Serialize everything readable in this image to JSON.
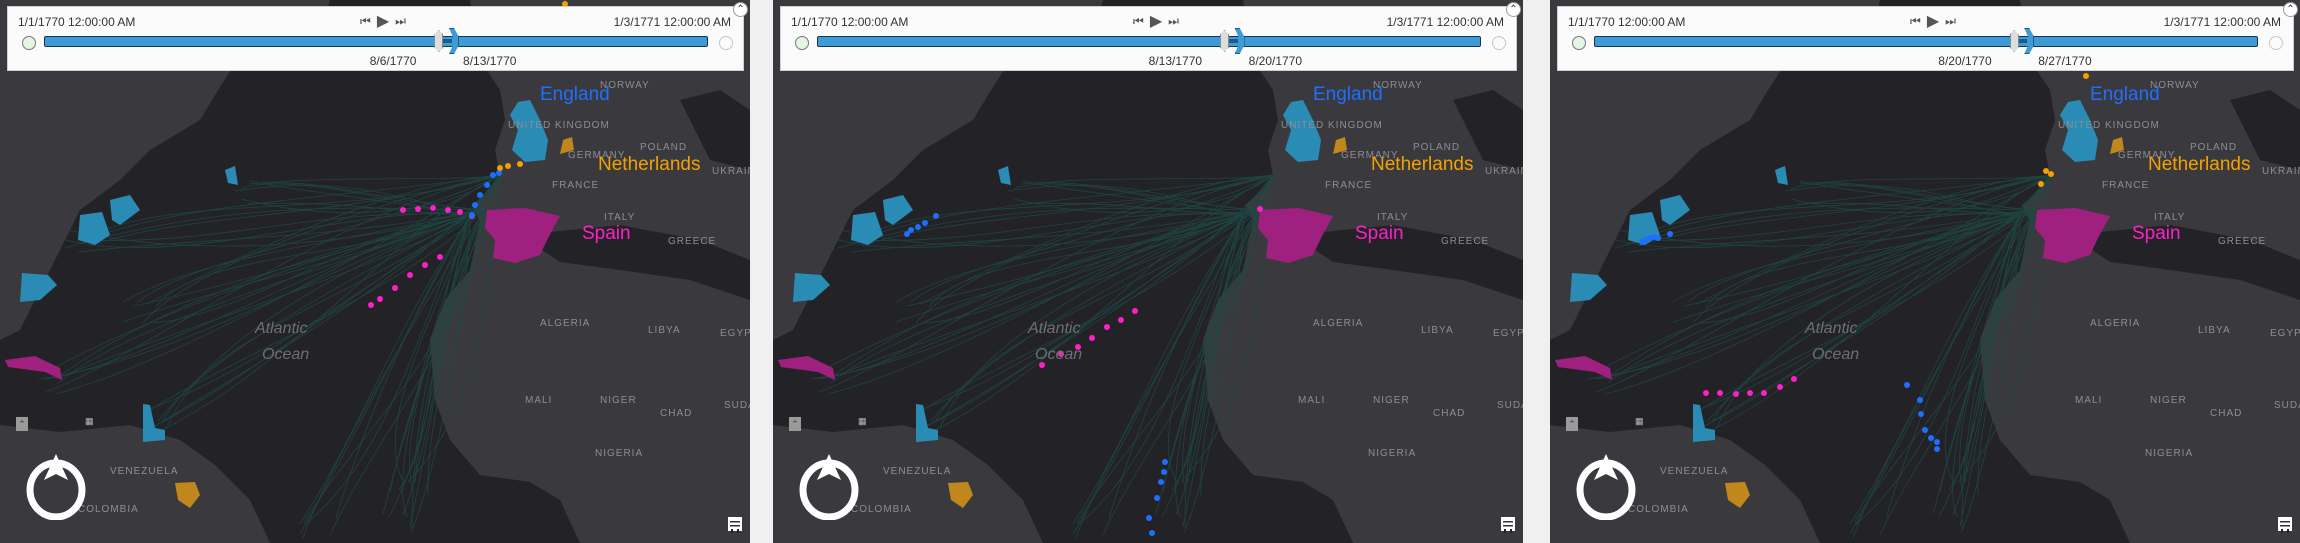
{
  "timeline": {
    "start_date": "1/1/1770 12:00:00 AM",
    "end_date": "1/3/1771 12:00:00 AM",
    "prev_icon": "skip-back-icon",
    "play_icon": "play-icon",
    "next_icon": "skip-forward-icon"
  },
  "panels": [
    {
      "range_start": "8/6/1770",
      "range_end": "8/13/1770",
      "start_fraction": 0.594,
      "end_fraction": 0.613
    },
    {
      "range_start": "8/13/1770",
      "range_end": "8/20/1770",
      "start_fraction": 0.613,
      "end_fraction": 0.632
    },
    {
      "range_start": "8/20/1770",
      "range_end": "8/27/1770",
      "start_fraction": 0.632,
      "end_fraction": 0.651
    }
  ],
  "legend": {
    "england": "England",
    "netherlands": "Netherlands",
    "spain": "Spain"
  },
  "colors": {
    "england": "#1f6fff",
    "netherlands": "#f5a000",
    "spain": "#ff1fc8",
    "england_region": "#2a8bb5",
    "netherlands_region": "#c2871c",
    "spain_region": "#a0207f",
    "track": "#1e4a46"
  },
  "map": {
    "ocean_line1": "Atlantic",
    "ocean_line2": "Ocean",
    "countries": [
      "NORWAY",
      "UNITED KINGDOM",
      "GERMANY",
      "POLAND",
      "FRANCE",
      "ITALY",
      "GREECE",
      "ALGERIA",
      "LIBYA",
      "EGYPT",
      "MALI",
      "NIGER",
      "CHAD",
      "SUDAN",
      "NIGERIA",
      "VENEZUELA",
      "COLOMBIA",
      "UKRAINE"
    ]
  }
}
